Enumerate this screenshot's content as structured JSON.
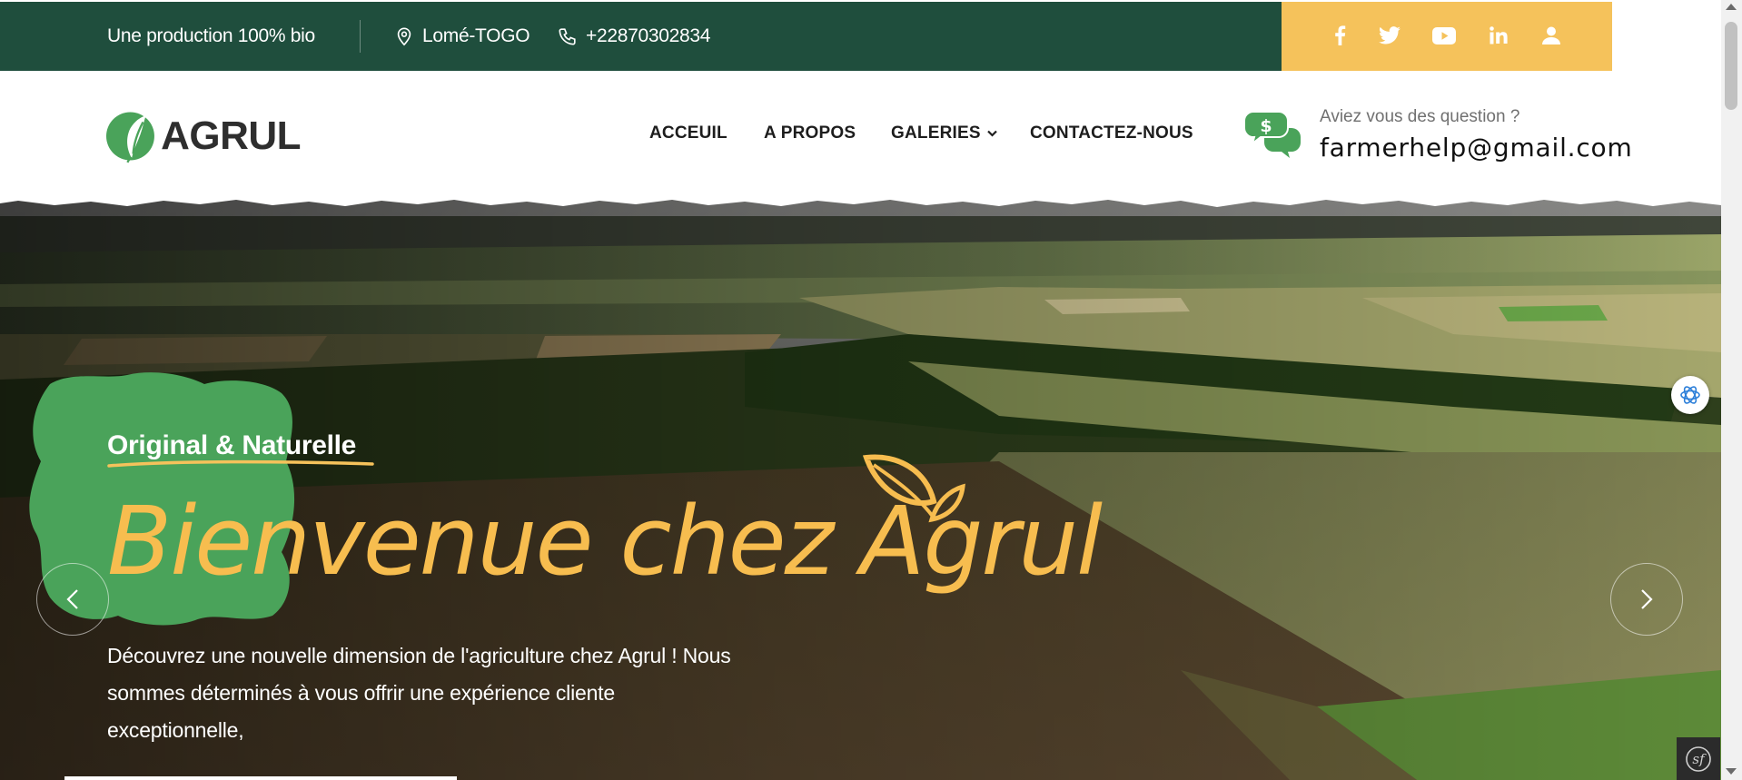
{
  "topbar": {
    "tagline": "Une production 100% bio",
    "location": "Lomé-TOGO",
    "phone": "+22870302834",
    "social": [
      "facebook-icon",
      "twitter-icon",
      "youtube-icon",
      "linkedin-icon",
      "user-icon"
    ]
  },
  "header": {
    "logo_text": "AGRUL",
    "nav": [
      {
        "label": "ACCEUIL"
      },
      {
        "label": "A PROPOS"
      },
      {
        "label": "GALERIES"
      },
      {
        "label": "CONTACTEZ-NOUS"
      }
    ],
    "help": {
      "question": "Aviez vous des question ?",
      "email": "farmerhelp@gmail.com"
    }
  },
  "hero": {
    "subtitle": "Original & Naturelle",
    "title": "Bienvenue chez Agrul",
    "description": "Découvrez une nouvelle dimension de l'agriculture chez Agrul ! Nous sommes déterminés à vous offrir une expérience cliente exceptionnelle,"
  },
  "colors": {
    "topbar_green": "#1f4e3d",
    "topbar_yellow": "#f5c25b",
    "brand_green": "#4aa35a",
    "title_yellow": "#f7bd4f",
    "text_dark": "#1d1d1d"
  }
}
